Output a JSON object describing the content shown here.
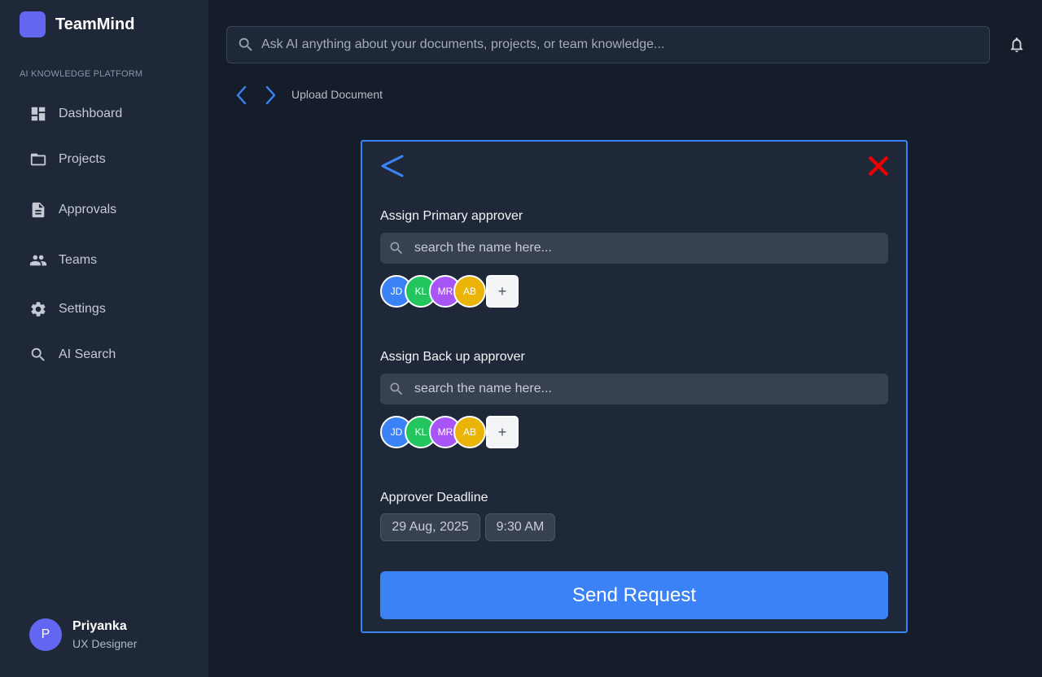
{
  "app": {
    "name": "TeamMind",
    "section_label": "AI KNOWLEDGE PLATFORM",
    "brand_color": "#6366f1"
  },
  "sidebar": {
    "items": [
      {
        "label": "Dashboard",
        "icon": "dashboard-icon"
      },
      {
        "label": "Projects",
        "icon": "folder-icon"
      },
      {
        "label": "Approvals",
        "icon": "document-icon"
      },
      {
        "label": "Teams",
        "icon": "people-icon"
      },
      {
        "label": "Settings",
        "icon": "gear-icon"
      },
      {
        "label": "AI Search",
        "icon": "search-icon"
      }
    ]
  },
  "user": {
    "initial": "P",
    "name": "Priyanka",
    "role": "UX Designer"
  },
  "header": {
    "search_placeholder": "Ask AI anything about your documents, projects, or team knowledge...",
    "breadcrumb": "Upload Document"
  },
  "modal": {
    "primary": {
      "label": "Assign Primary approver",
      "search_placeholder": "search the name here...",
      "avatars": [
        {
          "initials": "JD",
          "color": "#3b82f6"
        },
        {
          "initials": "KL",
          "color": "#22c55e"
        },
        {
          "initials": "MR",
          "color": "#a855f7"
        },
        {
          "initials": "AB",
          "color": "#eab308"
        }
      ],
      "add_label": "+"
    },
    "backup": {
      "label": "Assign Back up approver",
      "search_placeholder": "search the name here...",
      "avatars": [
        {
          "initials": "JD",
          "color": "#3b82f6"
        },
        {
          "initials": "KL",
          "color": "#22c55e"
        },
        {
          "initials": "MR",
          "color": "#a855f7"
        },
        {
          "initials": "AB",
          "color": "#eab308"
        }
      ],
      "add_label": "+"
    },
    "deadline": {
      "label": "Approver Deadline",
      "date": "29 Aug, 2025",
      "time": "9:30 AM"
    },
    "send_label": "Send Request",
    "accent": "#3b82f6",
    "close_color": "#ef0000"
  }
}
